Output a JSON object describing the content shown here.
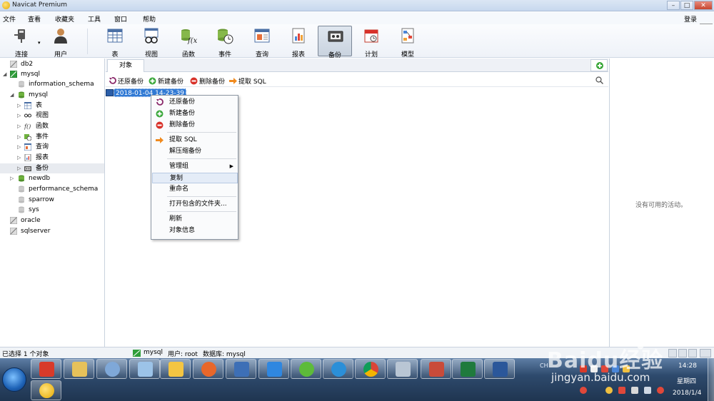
{
  "window": {
    "title": "Navicat Premium"
  },
  "menubar": {
    "items": [
      "文件",
      "查看",
      "收藏夹",
      "工具",
      "窗口",
      "帮助"
    ],
    "login": "登录"
  },
  "toolbar": {
    "buttons": [
      {
        "label": "连接",
        "icon": "plug-icon"
      },
      {
        "label": "用户",
        "icon": "user-icon"
      },
      {
        "label": "表",
        "icon": "table-icon"
      },
      {
        "label": "视图",
        "icon": "view-glasses-icon"
      },
      {
        "label": "函数",
        "icon": "function-icon"
      },
      {
        "label": "事件",
        "icon": "event-clock-icon"
      },
      {
        "label": "查询",
        "icon": "query-icon"
      },
      {
        "label": "报表",
        "icon": "report-icon"
      },
      {
        "label": "备份",
        "icon": "backup-icon",
        "active": true
      },
      {
        "label": "计划",
        "icon": "calendar-icon"
      },
      {
        "label": "模型",
        "icon": "model-icon"
      }
    ]
  },
  "sidebar": {
    "items": [
      {
        "label": "db2",
        "level": 0,
        "icon": "connection-icon"
      },
      {
        "label": "mysql",
        "level": 0,
        "icon": "mysql-connection-icon",
        "expanded": true
      },
      {
        "label": "information_schema",
        "level": 1,
        "icon": "database-icon"
      },
      {
        "label": "mysql",
        "level": 1,
        "icon": "database-icon",
        "expanded": true
      },
      {
        "label": "表",
        "level": 2,
        "icon": "table-icon"
      },
      {
        "label": "视图",
        "level": 2,
        "icon": "view-glasses-icon"
      },
      {
        "label": "函数",
        "level": 2,
        "icon": "function-icon"
      },
      {
        "label": "事件",
        "level": 2,
        "icon": "event-clock-icon"
      },
      {
        "label": "查询",
        "level": 2,
        "icon": "query-icon"
      },
      {
        "label": "报表",
        "level": 2,
        "icon": "report-icon"
      },
      {
        "label": "备份",
        "level": 2,
        "icon": "backup-icon",
        "selected": true
      },
      {
        "label": "newdb",
        "level": 1,
        "icon": "database-icon"
      },
      {
        "label": "performance_schema",
        "level": 1,
        "icon": "database-icon"
      },
      {
        "label": "sparrow",
        "level": 1,
        "icon": "database-icon"
      },
      {
        "label": "sys",
        "level": 1,
        "icon": "database-icon"
      },
      {
        "label": "oracle",
        "level": 0,
        "icon": "connection-icon"
      },
      {
        "label": "sqlserver",
        "level": 0,
        "icon": "connection-icon"
      }
    ]
  },
  "object_tabs": {
    "active": "对象"
  },
  "object_toolbar": {
    "restore": "还原备份",
    "new": "新建备份",
    "delete": "删除备份",
    "extract": "提取 SQL"
  },
  "content": {
    "backup_item": "2018-01-04 14-23-39"
  },
  "context_menu": {
    "restore": "还原备份",
    "new": "新建备份",
    "delete": "删除备份",
    "extract": "提取 SQL",
    "decompress": "解压缩备份",
    "manage_group": "管理组",
    "copy": "复制",
    "rename": "重命名",
    "open_folder": "打开包含的文件夹...",
    "refresh": "刷新",
    "object_info": "对象信息"
  },
  "right_panel": {
    "no_activity": "没有可用的活动。"
  },
  "statusbar": {
    "selected": "已选择 1 个对象",
    "connection": "mysql",
    "user": "用户: root",
    "database": "数据库: mysql"
  },
  "taskbar": {
    "lang": "CH",
    "time": "14:28",
    "weekday": "星期四",
    "date": "2018/1/4"
  },
  "watermark": {
    "brand": "Baidu经验",
    "url": "jingyan.baidu.com"
  },
  "colors": {
    "selection": "#3079d4",
    "restore": "#8b2a6b",
    "new": "#3aa73a",
    "delete": "#d8322a",
    "extract": "#f08a1e"
  }
}
